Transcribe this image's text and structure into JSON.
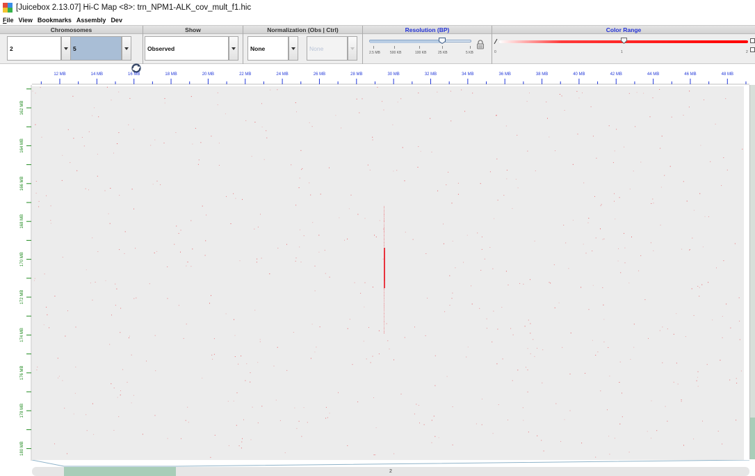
{
  "window": {
    "title": "[Juicebox 2.13.07] Hi-C Map <8>: trn_NPM1-ALK_cov_mult_f1.hic"
  },
  "menu": [
    {
      "key": "F",
      "rest": "ile"
    },
    {
      "key": "",
      "rest": "View"
    },
    {
      "key": "",
      "rest": "Bookmarks"
    },
    {
      "key": "",
      "rest": "Assembly"
    },
    {
      "key": "",
      "rest": "Dev"
    }
  ],
  "toolbar": {
    "chromosomes": {
      "header": "Chromosomes",
      "chrom_x": "2",
      "chrom_y": "5"
    },
    "show": {
      "header": "Show",
      "value": "Observed"
    },
    "normalization": {
      "header": "Normalization (Obs | Ctrl)",
      "obs": "None",
      "ctrl": "None"
    },
    "resolution": {
      "header": "Resolution (BP)",
      "ticks": [
        "2.5 MB",
        "500 KB",
        "100 KB",
        "25 KB",
        "5 KB"
      ],
      "level": 0.72
    },
    "color_range": {
      "header": "Color Range",
      "min": "0",
      "mid": "1",
      "max": "2",
      "level": 0.5
    }
  },
  "axes": {
    "x_ticks": [
      "12 MB",
      "14 MB",
      "16 MB",
      "18 MB",
      "20 MB",
      "22 MB",
      "24 MB",
      "26 MB",
      "28 MB",
      "30 MB",
      "32 MB",
      "34 MB",
      "36 MB",
      "38 MB",
      "40 MB",
      "42 MB",
      "44 MB",
      "46 MB",
      "48 MB"
    ],
    "y_ticks": [
      "162 MB",
      "164 MB",
      "166 MB",
      "168 MB",
      "170 MB",
      "172 MB",
      "174 MB",
      "176 MB",
      "178 MB",
      "180 MB"
    ]
  },
  "map": {
    "signal_color": "#e8323c",
    "background": "#ececec",
    "signal_x_mb": 29.6
  },
  "scroll": {
    "label": "2"
  },
  "colors": {
    "axis_blue": "#2238d8",
    "axis_green": "#1f8a1f",
    "accent_red": "#ff0000"
  }
}
